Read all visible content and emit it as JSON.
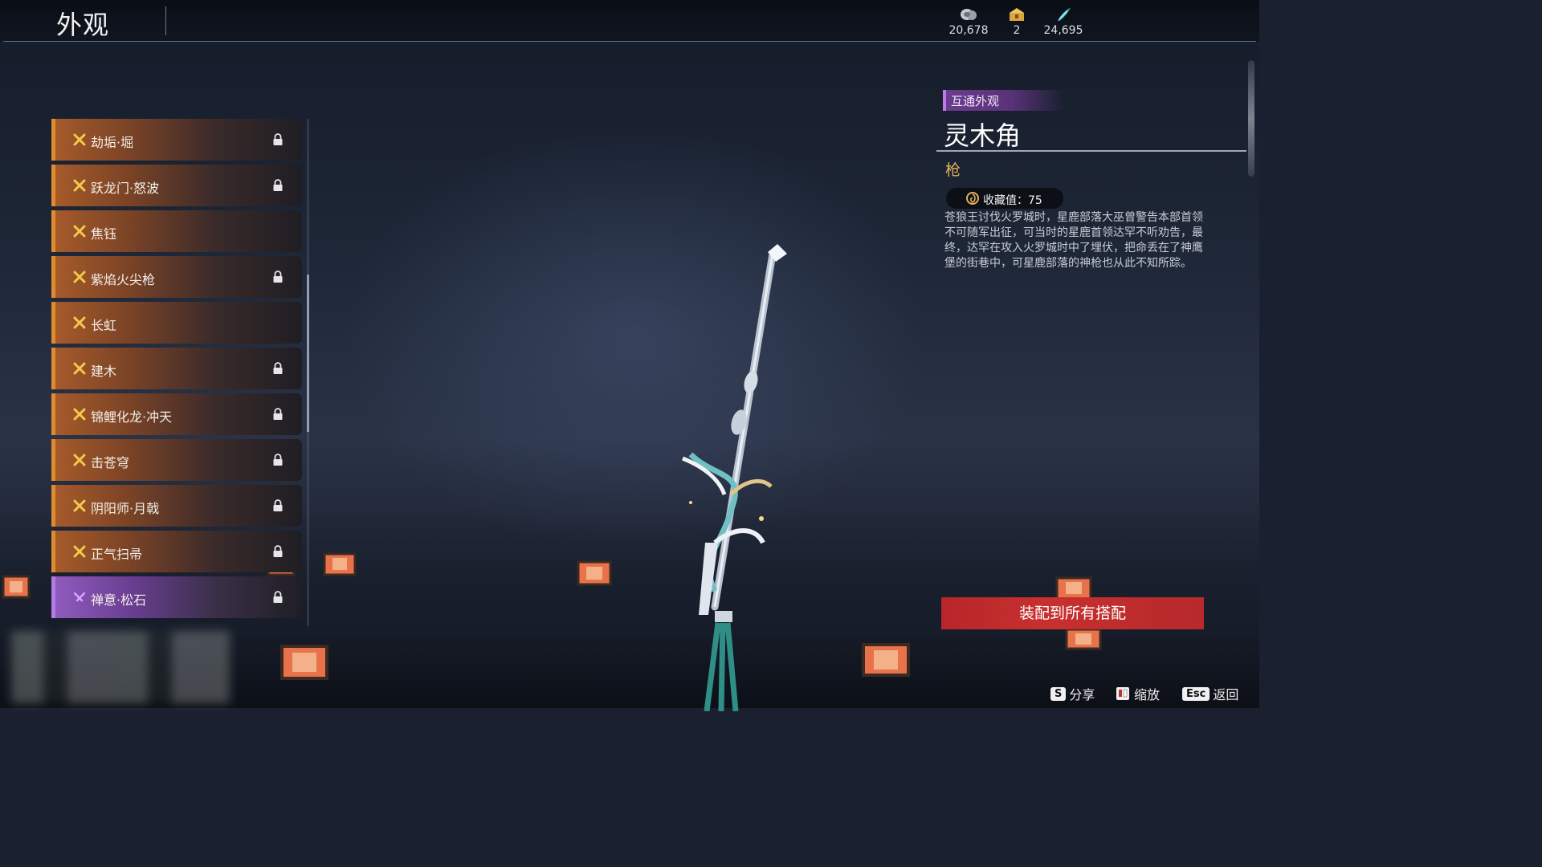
{
  "header": {
    "title": "外观"
  },
  "currencies": [
    {
      "icon": "coin-icon",
      "value": "20,678"
    },
    {
      "icon": "chest-icon",
      "value": "2"
    },
    {
      "icon": "feather-icon",
      "value": "24,695"
    }
  ],
  "list": {
    "items": [
      {
        "name": "劫垢·堀",
        "locked": true,
        "rarity": "orange"
      },
      {
        "name": "跃龙门·怒波",
        "locked": true,
        "rarity": "orange"
      },
      {
        "name": "焦钰",
        "locked": false,
        "rarity": "orange"
      },
      {
        "name": "紫焰火尖枪",
        "locked": true,
        "rarity": "orange"
      },
      {
        "name": "长虹",
        "locked": false,
        "rarity": "orange"
      },
      {
        "name": "建木",
        "locked": true,
        "rarity": "orange"
      },
      {
        "name": "锦鲤化龙·冲天",
        "locked": true,
        "rarity": "orange"
      },
      {
        "name": "击苍穹",
        "locked": true,
        "rarity": "orange"
      },
      {
        "name": "阴阳师·月戟",
        "locked": true,
        "rarity": "orange"
      },
      {
        "name": "正气扫帚",
        "locked": true,
        "rarity": "orange"
      },
      {
        "name": "禅意·松石",
        "locked": true,
        "rarity": "purple"
      }
    ]
  },
  "detail": {
    "tag": "互通外观",
    "name": "灵木角",
    "type": "枪",
    "collect_label": "收藏值：75",
    "description": "苍狼王讨伐火罗城时，星鹿部落大巫曾警告本部首领不可随军出征，可当时的星鹿首领达罕不听劝告，最终，达罕在攻入火罗城时中了埋伏，把命丢在了神鹰堡的街巷中，可星鹿部落的神枪也从此不知所踪。",
    "equip_label": "装配到所有搭配"
  },
  "hints": {
    "share_key": "S",
    "share_label": "分享",
    "zoom_label": "缩放",
    "back_key": "Esc",
    "back_label": "返回"
  },
  "colors": {
    "orange_accent": "#e08b2f",
    "purple_accent": "#b27be6",
    "equip_red": "#c7302e",
    "type_gold": "#e3b25a"
  }
}
